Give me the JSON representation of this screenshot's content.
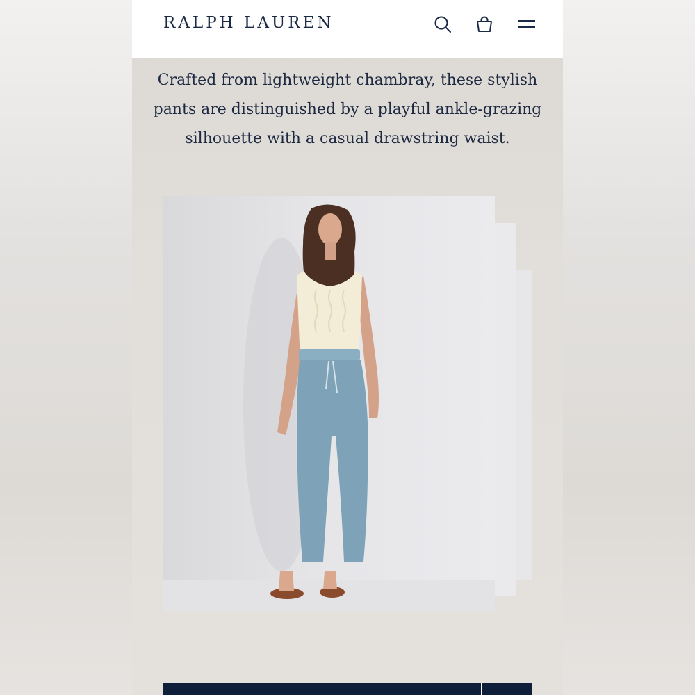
{
  "header": {
    "brand": "RALPH LAUREN",
    "icons": [
      "search-icon",
      "shopping-bag-icon",
      "hamburger-menu-icon"
    ]
  },
  "product": {
    "description": "Crafted from lightweight chambray, these stylish pants are distinguished by a playful ankle-grazing silhouette with a casual drawstring waist."
  },
  "colors": {
    "brand_navy": "#1b2a44",
    "cta_navy": "#0f1f3a",
    "tank_cream": "#f3ecd6",
    "pants_chambray": "#7ea3b8"
  }
}
